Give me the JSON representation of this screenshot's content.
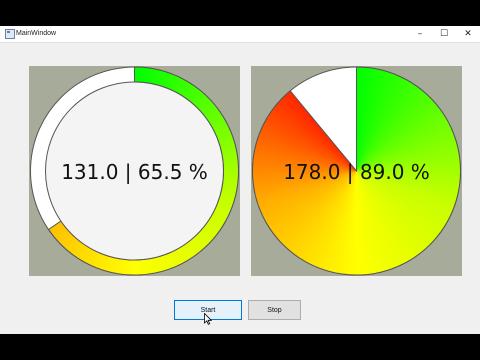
{
  "window": {
    "title": "MainWindow",
    "controls": {
      "minimize": "–",
      "maximize": "☐",
      "close": "✕"
    }
  },
  "gauges": [
    {
      "value": 131.0,
      "percent": 65.5,
      "readout": "131.0 | 65.5 %",
      "style": "ring"
    },
    {
      "value": 178.0,
      "percent": 89.0,
      "readout": "178.0 | 89.0 %",
      "style": "pie"
    }
  ],
  "buttons": {
    "start": "Start",
    "stop": "Stop"
  },
  "colors": {
    "panel_bg": "#a6ab9a",
    "gauge_empty": "#ffffff",
    "gauge_inner": "#f4f4f4",
    "gradient_green": "#00ff00",
    "gradient_yellow": "#ffff00",
    "gradient_red": "#ff2800"
  }
}
